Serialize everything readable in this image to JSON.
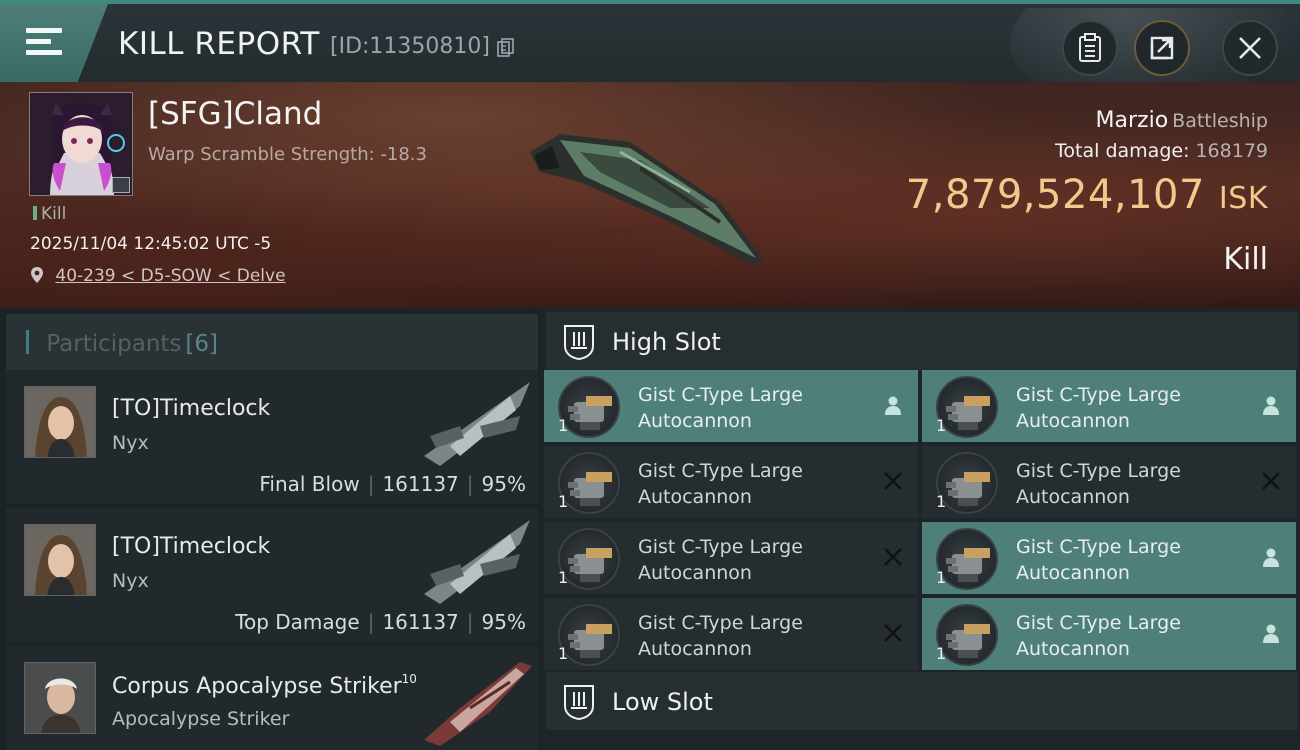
{
  "header": {
    "title": "KILL REPORT",
    "report_id": "[ID:11350810]"
  },
  "victim": {
    "name": "[SFG]Cland",
    "warp_scramble": "Warp Scramble Strength: -18.3",
    "status": "Kill",
    "datetime": "2025/11/04 12:45:02 UTC -5",
    "location": "40-239 < D5-SOW < Delve",
    "ship_name": "Marzio",
    "ship_class": "Battleship",
    "total_damage_label": "Total damage:",
    "total_damage": "168179",
    "isk_value": "7,879,524,107",
    "isk_unit": "ISK",
    "result": "Kill"
  },
  "participants": {
    "title": "Participants",
    "count": "[6]",
    "rows": [
      {
        "name": "[TO]Timeclock",
        "ship": "Nyx",
        "role": "Final Blow",
        "damage": "161137",
        "percent": "95%"
      },
      {
        "name": "[TO]Timeclock",
        "ship": "Nyx",
        "role": "Top Damage",
        "damage": "161137",
        "percent": "95%"
      },
      {
        "name": "Corpus Apocalypse Striker",
        "level": "10",
        "ship": "Apocalypse Striker"
      }
    ]
  },
  "slots": {
    "high": {
      "title": "High Slot",
      "modules": [
        {
          "line1": "Gist C-Type Large",
          "line2": "Autocannon",
          "qty": "1",
          "status": "dropped"
        },
        {
          "line1": "Gist C-Type Large",
          "line2": "Autocannon",
          "qty": "1",
          "status": "dropped"
        },
        {
          "line1": "Gist C-Type Large",
          "line2": "Autocannon",
          "qty": "1",
          "status": "destroyed"
        },
        {
          "line1": "Gist C-Type Large",
          "line2": "Autocannon",
          "qty": "1",
          "status": "destroyed"
        },
        {
          "line1": "Gist C-Type Large",
          "line2": "Autocannon",
          "qty": "1",
          "status": "destroyed"
        },
        {
          "line1": "Gist C-Type Large",
          "line2": "Autocannon",
          "qty": "1",
          "status": "dropped"
        },
        {
          "line1": "Gist C-Type Large",
          "line2": "Autocannon",
          "qty": "1",
          "status": "destroyed"
        },
        {
          "line1": "Gist C-Type Large",
          "line2": "Autocannon",
          "qty": "1",
          "status": "dropped"
        }
      ]
    },
    "low": {
      "title": "Low Slot"
    }
  },
  "colors": {
    "accent": "#4f7f79",
    "isk": "#f2c98a",
    "header_strip": "#3f8a80"
  },
  "icons": [
    "menu-icon",
    "copy-icon",
    "clipboard-icon",
    "share-icon",
    "close-icon",
    "location-pin-icon",
    "slot-icon",
    "dropped-icon",
    "destroyed-icon"
  ]
}
